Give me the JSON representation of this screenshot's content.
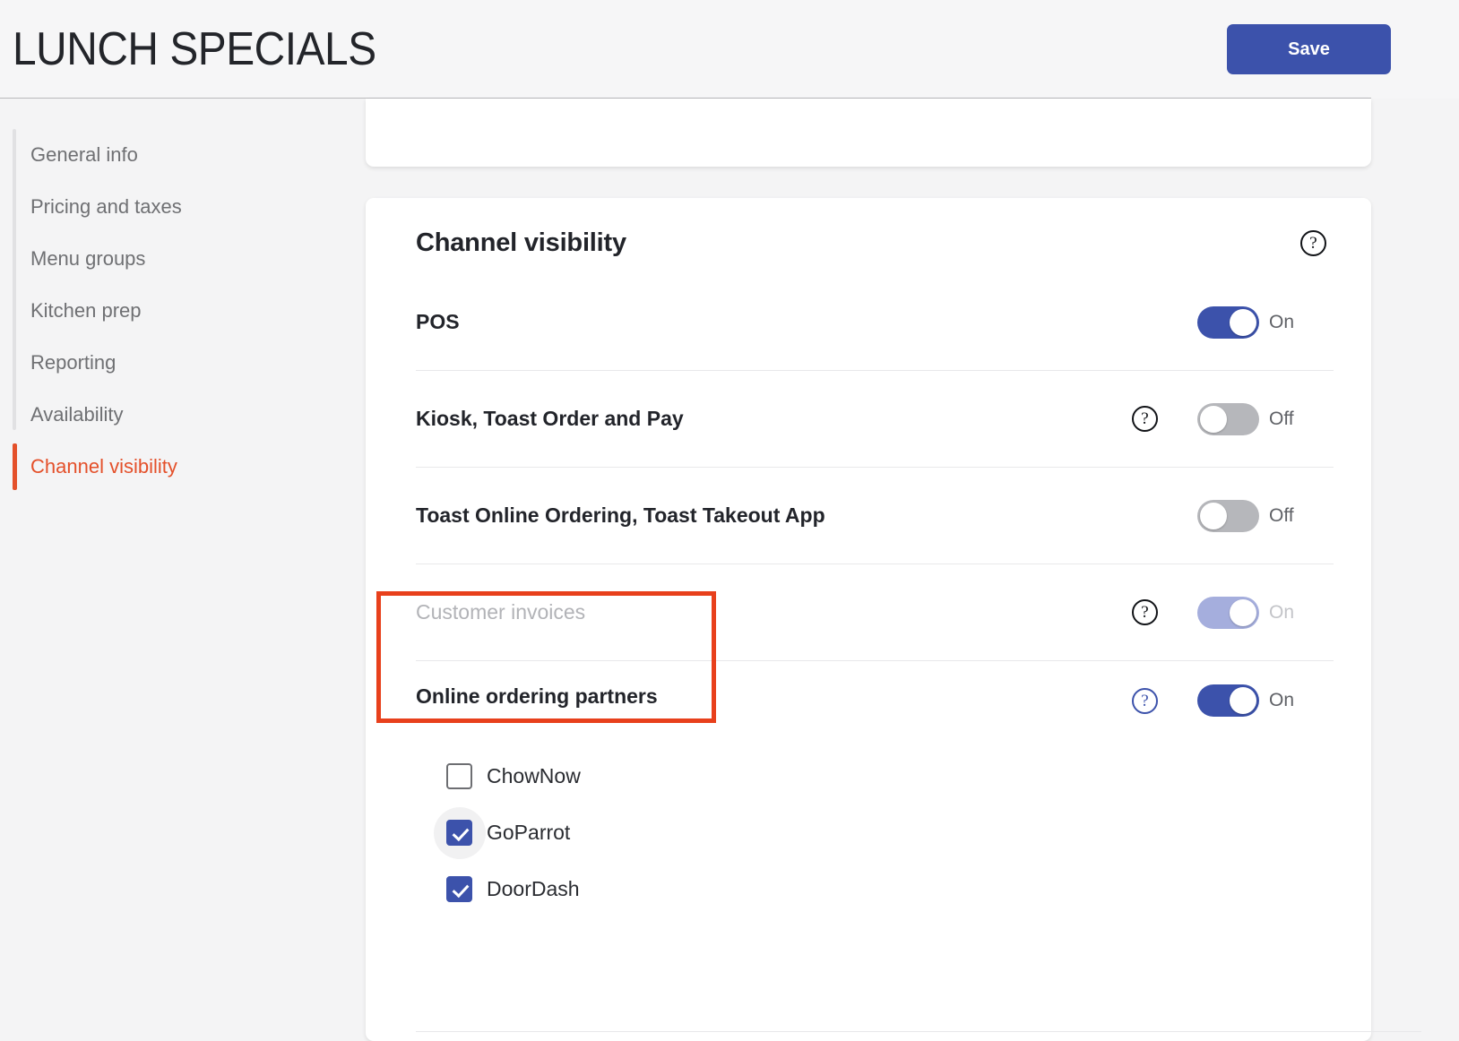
{
  "header": {
    "title": "LUNCH SPECIALS",
    "save_label": "Save"
  },
  "sidebar": {
    "items": [
      {
        "label": "General info",
        "active": false
      },
      {
        "label": "Pricing and taxes",
        "active": false
      },
      {
        "label": "Menu groups",
        "active": false
      },
      {
        "label": "Kitchen prep",
        "active": false
      },
      {
        "label": "Reporting",
        "active": false
      },
      {
        "label": "Availability",
        "active": false
      },
      {
        "label": "Channel visibility",
        "active": true
      }
    ]
  },
  "main": {
    "card_title": "Channel visibility",
    "help_icon": "question-mark-circle-icon",
    "rows": [
      {
        "label": "POS",
        "has_help": false,
        "toggle_state": "On",
        "toggle_on": true,
        "disabled": false
      },
      {
        "label": "Kiosk, Toast Order and Pay",
        "has_help": true,
        "toggle_state": "Off",
        "toggle_on": false,
        "disabled": false
      },
      {
        "label": "Toast Online Ordering, Toast Takeout App",
        "has_help": false,
        "toggle_state": "Off",
        "toggle_on": false,
        "disabled": false
      },
      {
        "label": "Customer invoices",
        "has_help": true,
        "toggle_state": "On",
        "toggle_on": true,
        "disabled": true
      }
    ],
    "partners": {
      "label": "Online ordering partners",
      "has_help": true,
      "help_focused": true,
      "toggle_state": "On",
      "toggle_on": true,
      "items": [
        {
          "label": "ChowNow",
          "checked": false,
          "hovered": false
        },
        {
          "label": "GoParrot",
          "checked": true,
          "hovered": true
        },
        {
          "label": "DoorDash",
          "checked": true,
          "hovered": false
        }
      ]
    }
  },
  "colors": {
    "accent_blue": "#3c52ab",
    "active_orange": "#e4502a",
    "annotation_red": "#e8401c",
    "page_background": "#f4f4f5",
    "card_background": "#ffffff"
  },
  "annotation": {
    "present": true,
    "target": "online-ordering-partners-and-chownow"
  }
}
